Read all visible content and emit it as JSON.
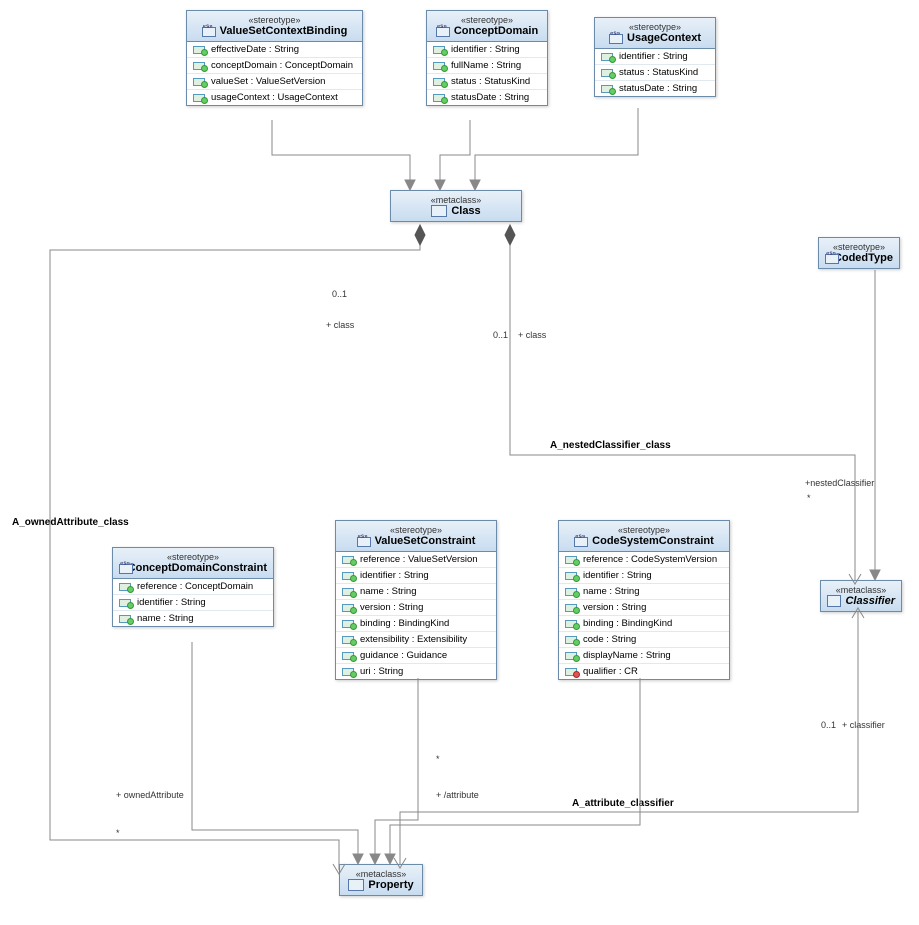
{
  "classes": {
    "valueSetContextBinding": {
      "stereotype": "«stereotype»",
      "name": "ValueSetContextBinding",
      "attrs": [
        "effectiveDate : String",
        "conceptDomain : ConceptDomain",
        "valueSet : ValueSetVersion",
        "usageContext : UsageContext"
      ]
    },
    "conceptDomain": {
      "stereotype": "«stereotype»",
      "name": "ConceptDomain",
      "attrs": [
        "identifier : String",
        "fullName : String",
        "status : StatusKind",
        "statusDate : String"
      ]
    },
    "usageContext": {
      "stereotype": "«stereotype»",
      "name": "UsageContext",
      "attrs": [
        "identifier : String",
        "status : StatusKind",
        "statusDate : String"
      ]
    },
    "classMeta": {
      "stereotype": "«metaclass»",
      "name": "Class"
    },
    "codedType": {
      "stereotype": "«stereotype»",
      "name": "CodedType"
    },
    "conceptDomainConstraint": {
      "stereotype": "«stereotype»",
      "name": "ConceptDomainConstraint",
      "attrs": [
        "reference : ConceptDomain",
        "identifier : String",
        "name : String"
      ]
    },
    "valueSetConstraint": {
      "stereotype": "«stereotype»",
      "name": "ValueSetConstraint",
      "attrs": [
        "reference : ValueSetVersion",
        "identifier : String",
        "name : String",
        "version : String",
        "binding : BindingKind",
        "extensibility : Extensibility",
        "guidance : Guidance",
        "uri : String"
      ]
    },
    "codeSystemConstraint": {
      "stereotype": "«stereotype»",
      "name": "CodeSystemConstraint",
      "attrs": [
        "reference : CodeSystemVersion",
        "identifier : String",
        "name : String",
        "version : String",
        "binding : BindingKind",
        "code : String",
        "displayName : String",
        "qualifier : CR"
      ]
    },
    "classifier": {
      "stereotype": "«metaclass»",
      "name": "Classifier"
    },
    "property": {
      "stereotype": "«metaclass»",
      "name": "Property"
    }
  },
  "labels": {
    "a_nestedClassifier": "A_nestedClassifier_class",
    "a_ownedAttribute": "A_ownedAttribute_class",
    "a_attribute_classifier": "A_attribute_classifier",
    "plus_class1": "+ class",
    "plus_class2": "+ class",
    "mult01_1": "0..1",
    "mult01_2": "0..1",
    "nestedClassifier": "+nestedClassifier",
    "star1": "*",
    "ownedAttribute": "+ ownedAttribute",
    "star2": "*",
    "plus_attribute": "+ /attribute",
    "mult01_3": "0..1",
    "plus_classifier": "+ classifier",
    "star3": "*"
  }
}
